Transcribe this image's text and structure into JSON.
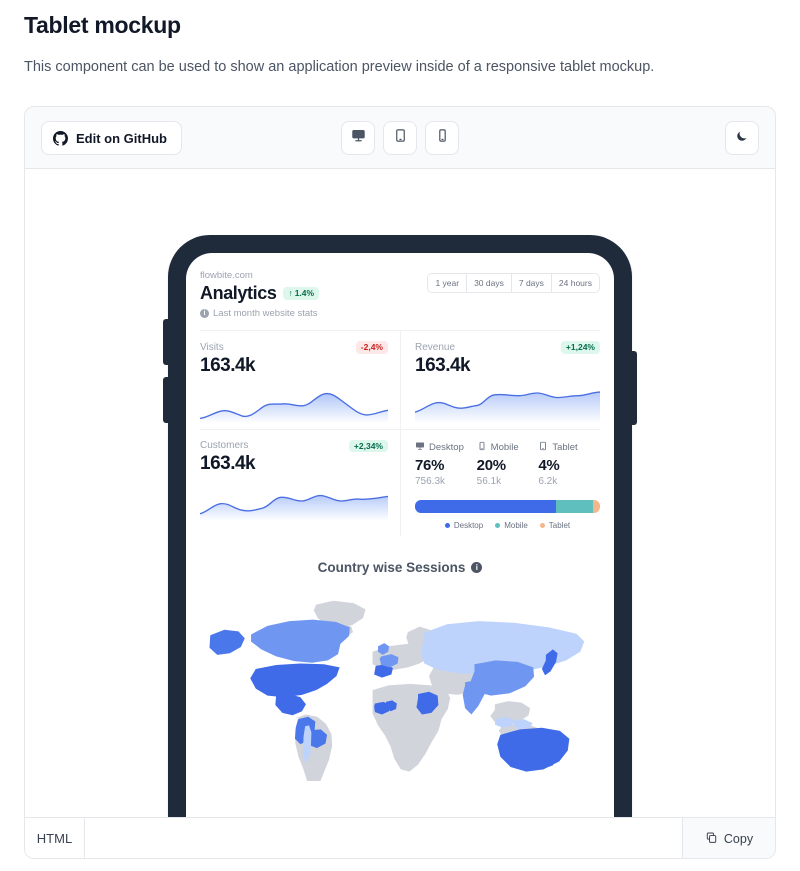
{
  "page": {
    "title": "Tablet mockup",
    "description": "This component can be used to show an application preview inside of a responsive tablet mockup."
  },
  "toolbar": {
    "github_label": "Edit on GitHub",
    "github_icon": "github-icon",
    "devices": [
      {
        "name": "desktop",
        "icon": "desktop-icon"
      },
      {
        "name": "tablet",
        "icon": "tablet-icon"
      },
      {
        "name": "mobile",
        "icon": "mobile-icon"
      }
    ],
    "theme_icon": "moon-icon"
  },
  "dashboard": {
    "site_url": "flowbite.com",
    "title": "Analytics",
    "title_badge": {
      "text": "1.4%",
      "direction": "up",
      "arrow": "↑",
      "color": "#046c4e",
      "bg": "#def7ec"
    },
    "subtitle": "Last month website stats",
    "subtitle_icon": "info-icon",
    "ranges": [
      "1 year",
      "30 days",
      "7 days",
      "24 hours"
    ],
    "stats": [
      {
        "label": "Visits",
        "value": "163.4k",
        "badge": "-2,4%",
        "badge_kind": "down"
      },
      {
        "label": "Revenue",
        "value": "163.4k",
        "badge": "+1,24%",
        "badge_kind": "up"
      },
      {
        "label": "Customers",
        "value": "163.4k",
        "badge": "+2,34%",
        "badge_kind": "up"
      }
    ],
    "devices": {
      "items": [
        {
          "label": "Desktop",
          "icon": "desktop-icon",
          "percent": "76%",
          "count": "756.3k",
          "color": "#3f6ae8",
          "share": 76
        },
        {
          "label": "Mobile",
          "icon": "mobile-icon",
          "percent": "20%",
          "count": "56.1k",
          "color": "#5fbfbf",
          "share": 20
        },
        {
          "label": "Tablet",
          "icon": "tablet-icon",
          "percent": "4%",
          "count": "6.2k",
          "color": "#f5b68a",
          "share": 4
        }
      ]
    },
    "map": {
      "title": "Country wise Sessions",
      "info_icon": "info-icon"
    }
  },
  "codebar": {
    "tab_label": "HTML",
    "copy_label": "Copy",
    "copy_icon": "copy-icon"
  },
  "chart_data": [
    {
      "type": "area",
      "title": "Visits",
      "ylabel": "",
      "xlabel": "",
      "total": "163.4k",
      "change": "-2,4%",
      "values": [
        12,
        14,
        20,
        26,
        24,
        16,
        13,
        15,
        26,
        34,
        46,
        48,
        44,
        40,
        42,
        52,
        60,
        56,
        44,
        34,
        26,
        22,
        30,
        32
      ]
    },
    {
      "type": "area",
      "title": "Revenue",
      "ylabel": "",
      "xlabel": "",
      "total": "163.4k",
      "change": "+1,24%",
      "values": [
        18,
        24,
        30,
        36,
        34,
        28,
        26,
        30,
        46,
        50,
        48,
        50,
        52,
        48,
        44,
        46,
        44,
        42,
        44,
        46,
        42,
        48,
        52,
        54
      ]
    },
    {
      "type": "area",
      "title": "Customers",
      "ylabel": "",
      "xlabel": "",
      "total": "163.4k",
      "change": "+2,34%",
      "values": [
        10,
        16,
        26,
        32,
        30,
        24,
        22,
        26,
        40,
        44,
        42,
        44,
        50,
        46,
        42,
        48,
        44,
        42,
        40,
        44,
        40,
        44,
        48,
        50
      ]
    },
    {
      "type": "bar",
      "title": "Device share",
      "categories": [
        "Desktop",
        "Mobile",
        "Tablet"
      ],
      "values": [
        76,
        20,
        4
      ],
      "value_labels": [
        "756.3k",
        "56.1k",
        "6.2k"
      ],
      "colors": [
        "#3f6ae8",
        "#5fbfbf",
        "#f5b68a"
      ],
      "legend_position": "bottom",
      "ylim": [
        0,
        100
      ]
    },
    {
      "type": "heatmap",
      "title": "Country wise Sessions",
      "subtype": "choropleth-world-map",
      "legend_position": "none",
      "scale_colors": [
        "#d1d5db",
        "#bed3fb",
        "#93b4f7",
        "#6f97f2",
        "#3f6ae8"
      ],
      "regions": [
        {
          "name": "United States",
          "level": 4
        },
        {
          "name": "Canada",
          "level": 3
        },
        {
          "name": "Greenland",
          "level": 0
        },
        {
          "name": "Mexico",
          "level": 4
        },
        {
          "name": "Brazil",
          "level": 0
        },
        {
          "name": "Peru",
          "level": 3
        },
        {
          "name": "Bolivia",
          "level": 3
        },
        {
          "name": "Chile",
          "level": 1
        },
        {
          "name": "Russia",
          "level": 1
        },
        {
          "name": "China",
          "level": 3
        },
        {
          "name": "India",
          "level": 3
        },
        {
          "name": "Japan",
          "level": 4
        },
        {
          "name": "Australia",
          "level": 4
        },
        {
          "name": "Indonesia",
          "level": 0
        },
        {
          "name": "France",
          "level": 3
        },
        {
          "name": "Spain",
          "level": 4
        },
        {
          "name": "United Kingdom",
          "level": 3
        },
        {
          "name": "Africa (most)",
          "level": 0
        },
        {
          "name": "Sudan",
          "level": 4
        },
        {
          "name": "Ghana",
          "level": 4
        }
      ]
    }
  ]
}
